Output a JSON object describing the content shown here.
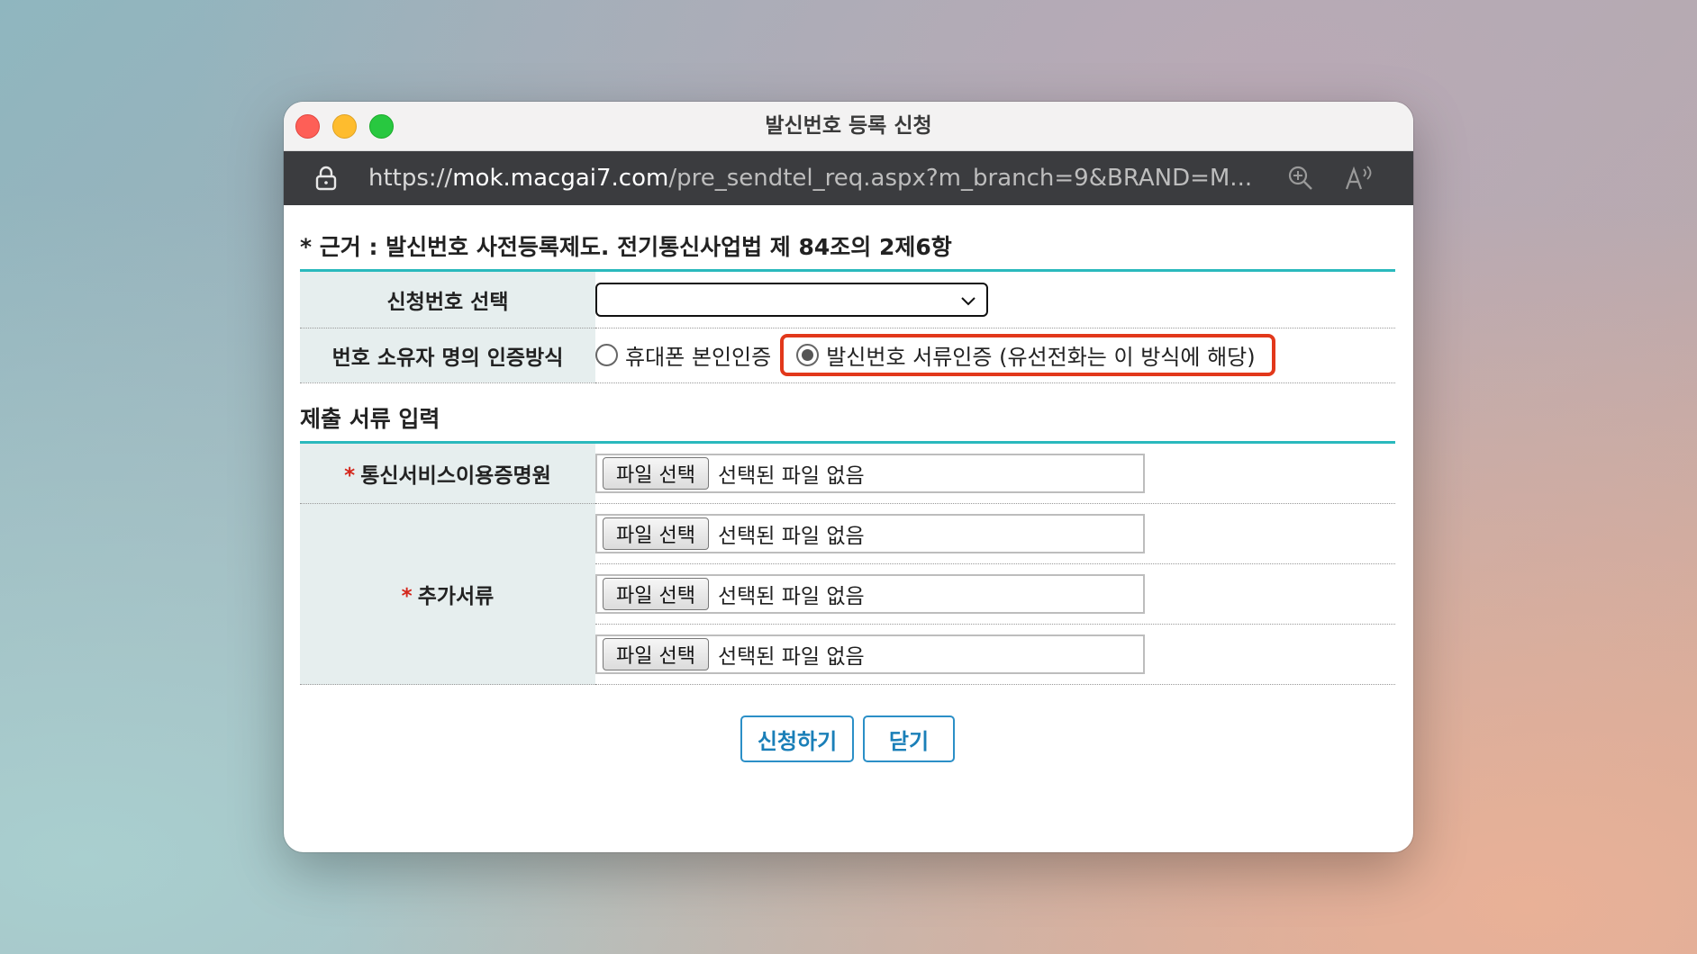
{
  "window": {
    "title": "발신번호 등록 신청",
    "url_scheme": "https://",
    "url_host": "mok.macgai7.com",
    "url_path": "/pre_sendtel_req.aspx?m_branch=9&BRAND=M..."
  },
  "basis": "* 근거 : 발신번호 사전등록제도. 전기통신사업법 제 84조의 2제6항",
  "form": {
    "request_number_label": "신청번호 선택",
    "request_number_value": "",
    "auth_method_label": "번호 소유자 명의 인증방식",
    "auth_option_phone": "휴대폰 본인인증",
    "auth_option_docs": "발신번호 서류인증 (유선전화는 이 방식에 해당)"
  },
  "docs": {
    "section_title": "제출 서류 입력",
    "required_mark": "*",
    "telecom_cert_label": "통신서비스이용증명원",
    "extra_docs_label": "추가서류",
    "file_button": "파일 선택",
    "no_file": "선택된 파일 없음"
  },
  "actions": {
    "submit": "신청하기",
    "close": "닫기"
  },
  "colors": {
    "accent_line": "#2ab9bd",
    "highlight": "#e2381b",
    "button_border": "#2b8fc7"
  }
}
